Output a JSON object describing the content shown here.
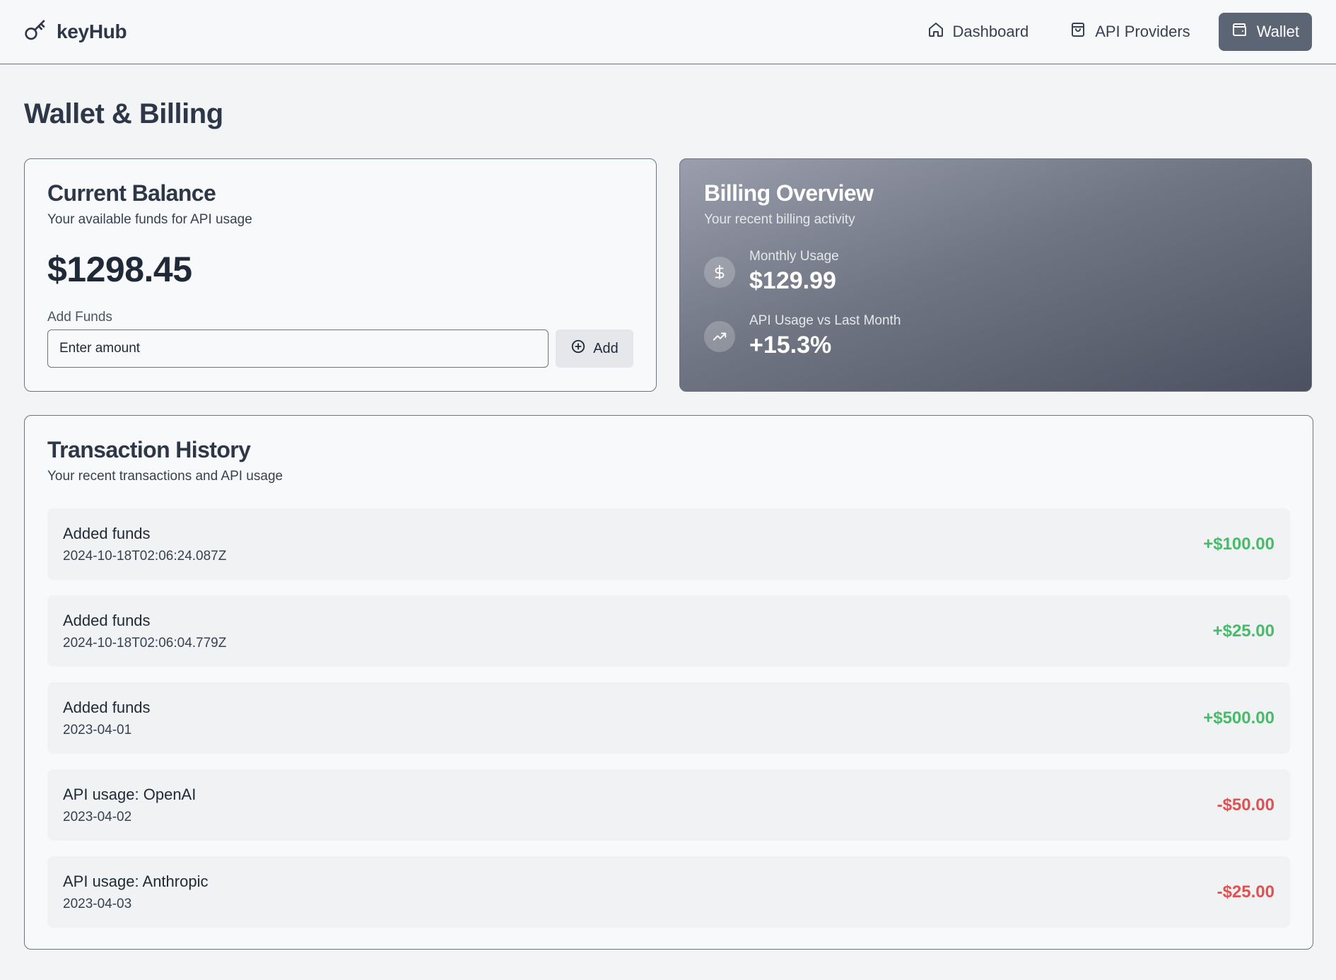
{
  "header": {
    "brand": "keyHub",
    "nav": [
      {
        "label": "Dashboard",
        "icon": "home-icon",
        "active": false
      },
      {
        "label": "API Providers",
        "icon": "shopping-bag-icon",
        "active": false
      },
      {
        "label": "Wallet",
        "icon": "wallet-icon",
        "active": true
      }
    ]
  },
  "page": {
    "title": "Wallet & Billing"
  },
  "balance": {
    "title": "Current Balance",
    "subtitle": "Your available funds for API usage",
    "amount": "$1298.45",
    "add_funds_label": "Add Funds",
    "input_placeholder": "Enter amount",
    "add_button": "Add"
  },
  "billing": {
    "title": "Billing Overview",
    "subtitle": "Your recent billing activity",
    "monthly_usage_label": "Monthly Usage",
    "monthly_usage_value": "$129.99",
    "usage_change_label": "API Usage vs Last Month",
    "usage_change_value": "+15.3%"
  },
  "transactions": {
    "title": "Transaction History",
    "subtitle": "Your recent transactions and API usage",
    "items": [
      {
        "description": "Added funds",
        "date": "2024-10-18T02:06:24.087Z",
        "amount": "+$100.00",
        "type": "credit"
      },
      {
        "description": "Added funds",
        "date": "2024-10-18T02:06:04.779Z",
        "amount": "+$25.00",
        "type": "credit"
      },
      {
        "description": "Added funds",
        "date": "2023-04-01",
        "amount": "+$500.00",
        "type": "credit"
      },
      {
        "description": "API usage: OpenAI",
        "date": "2023-04-02",
        "amount": "-$50.00",
        "type": "debit"
      },
      {
        "description": "API usage: Anthropic",
        "date": "2023-04-03",
        "amount": "-$25.00",
        "type": "debit"
      }
    ]
  },
  "colors": {
    "credit": "#48bb6b",
    "debit": "#e05252",
    "nav_active_bg": "#5c6573"
  }
}
